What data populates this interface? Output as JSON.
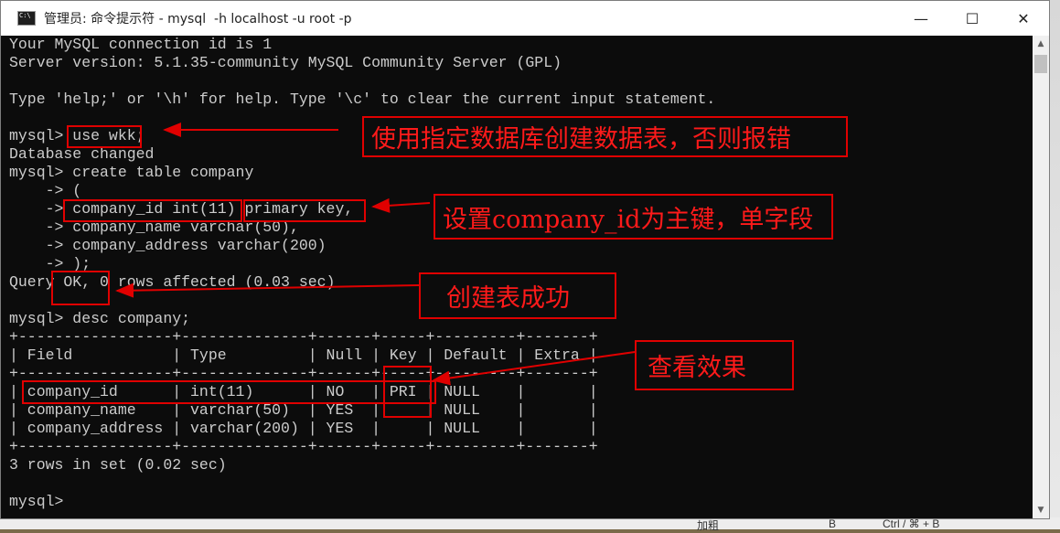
{
  "window": {
    "title": "管理员: 命令提示符 - mysql  -h localhost -u root -p",
    "controls": {
      "minimize": "—",
      "maximize": "☐",
      "close": "✕"
    }
  },
  "console": {
    "lines": [
      "Your MySQL connection id is 1",
      "Server version: 5.1.35-community MySQL Community Server (GPL)",
      "",
      "Type 'help;' or '\\h' for help. Type '\\c' to clear the current input statement.",
      "",
      "mysql> use wkk;",
      "Database changed",
      "mysql> create table company",
      "    -> (",
      "    -> company_id int(11) primary key,",
      "    -> company_name varchar(50),",
      "    -> company_address varchar(200)",
      "    -> );",
      "Query OK, 0 rows affected (0.03 sec)",
      "",
      "mysql> desc company;",
      "+-----------------+--------------+------+-----+---------+-------+",
      "| Field           | Type         | Null | Key | Default | Extra |",
      "+-----------------+--------------+------+-----+---------+-------+",
      "| company_id      | int(11)      | NO   | PRI | NULL    |       |",
      "| company_name    | varchar(50)  | YES  |     | NULL    |       |",
      "| company_address | varchar(200) | YES  |     | NULL    |       |",
      "+-----------------+--------------+------+-----+---------+-------+",
      "3 rows in set (0.02 sec)",
      "",
      "mysql>"
    ]
  },
  "annotations": {
    "use_db": "使用指定数据库创建数据表，否则报错",
    "primary_key": "设置company_id为主键，单字段",
    "created": "创建表成功",
    "result": "查看效果"
  },
  "background": {
    "bottom_left": "加粗",
    "bottom_mid": "B",
    "bottom_right": "Ctrl / ⌘ + B"
  },
  "colors": {
    "console_bg": "#0c0c0c",
    "console_text": "#cccccc",
    "annotation_red": "#e00000"
  }
}
